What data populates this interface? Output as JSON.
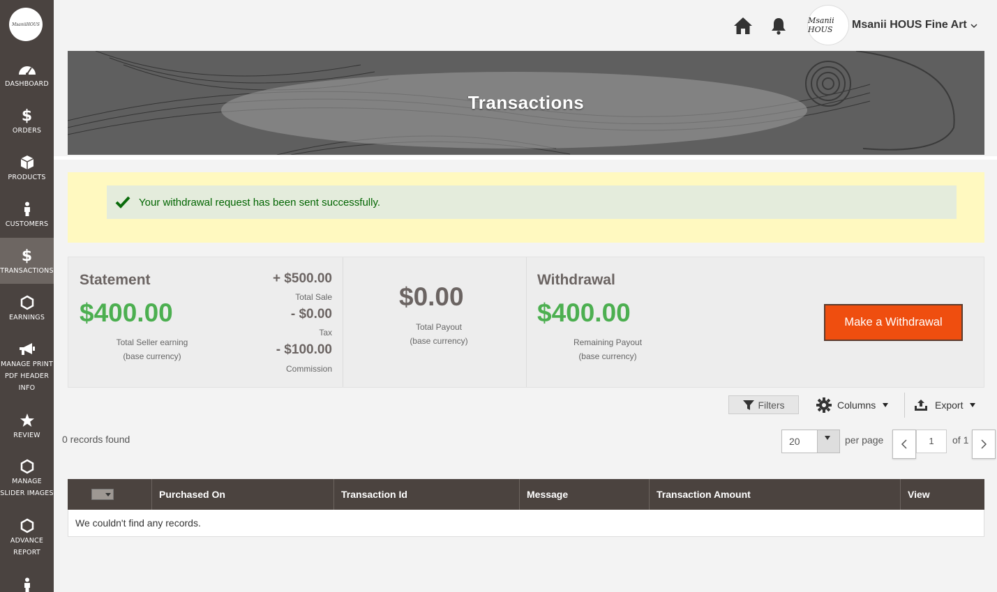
{
  "sidebar": {
    "logo_text": "MsaniiHOUS",
    "items": [
      {
        "label": "DASHBOARD",
        "icon": "dashboard-gauge-icon"
      },
      {
        "label": "ORDERS",
        "icon": "dollar-icon"
      },
      {
        "label": "PRODUCTS",
        "icon": "box-icon"
      },
      {
        "label": "CUSTOMERS",
        "icon": "person-icon"
      },
      {
        "label": "TRANSACTIONS",
        "icon": "dollar-icon",
        "active": true
      },
      {
        "label": "EARNINGS",
        "icon": "hexagon-icon"
      },
      {
        "label": "MANAGE PRINT PDF HEADER INFO",
        "icon": "megaphone-icon"
      },
      {
        "label": "REVIEW",
        "icon": "star-icon"
      },
      {
        "label": "MANAGE SLIDER IMAGES",
        "icon": "hexagon-icon"
      },
      {
        "label": "ADVANCE REPORT",
        "icon": "hexagon-icon"
      }
    ]
  },
  "header": {
    "avatar_text": "Msanii HOUS",
    "store_name": "Msanii HOUS Fine Art"
  },
  "banner": {
    "title": "Transactions"
  },
  "notice": {
    "message": "Your withdrawal request has been sent successfully."
  },
  "statement": {
    "title": "Statement",
    "total_seller_earning": "$400.00",
    "total_seller_earning_label": "Total Seller earning",
    "base_currency_label": "(base currency)",
    "total_sale": "+ $500.00",
    "total_sale_label": "Total Sale",
    "tax": "- $0.00",
    "tax_label": "Tax",
    "commission": "- $100.00",
    "commission_label": "Commission"
  },
  "payout": {
    "total_payout": "$0.00",
    "total_payout_label": "Total Payout",
    "base_currency_label": "(base currency)"
  },
  "withdrawal": {
    "title": "Withdrawal",
    "remaining_payout": "$400.00",
    "remaining_payout_label": "Remaining Payout",
    "base_currency_label": "(base currency)",
    "button_label": "Make a Withdrawal"
  },
  "toolbar": {
    "filters_label": "Filters",
    "columns_label": "Columns",
    "export_label": "Export"
  },
  "grid": {
    "records_found": "0 records found",
    "per_page_value": "20",
    "per_page_label": "per page",
    "current_page": "1",
    "of_pages": "of 1",
    "columns": [
      "Purchased On",
      "Transaction Id",
      "Message",
      "Transaction Amount",
      "View"
    ],
    "empty_message": "We couldn't find any records."
  },
  "colors": {
    "sidebar_bg": "#4a4340",
    "accent_green": "#4caf50",
    "withdraw_button": "#ef4e0f",
    "notice_bg": "#fff9c0",
    "header_grid_bg": "#4b433f"
  }
}
